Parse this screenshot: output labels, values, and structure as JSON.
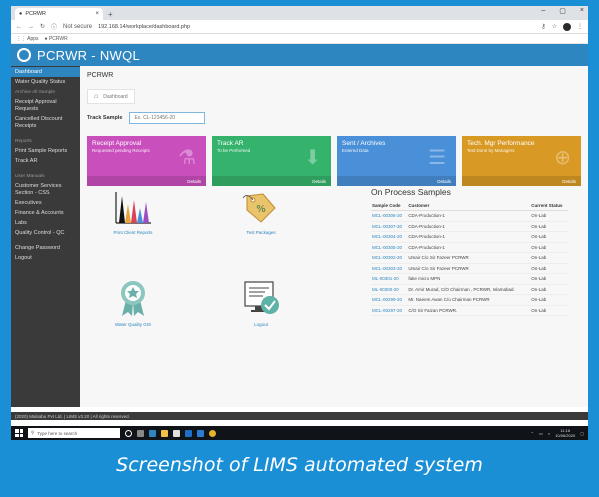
{
  "browser": {
    "tab_title": "PCRWR",
    "security_label": "Not secure",
    "url": "192.168.14/workplace/dashboard.php",
    "bookmarks": [
      "Apps",
      "PCRWR"
    ]
  },
  "app": {
    "title": "PCRWR - NWQL"
  },
  "sidebar": {
    "items": [
      {
        "label": "Dashboard",
        "active": true
      },
      {
        "label": "Water Quality Status"
      },
      {
        "label": "Archive All Sample",
        "sub": true
      },
      {
        "label": "Receipt Approval Requests"
      },
      {
        "label": "Cancelled Discount Receipts"
      },
      {
        "label": "Reports",
        "sub": true,
        "gap": true
      },
      {
        "label": "Print Sample Reports"
      },
      {
        "label": "Track AR"
      },
      {
        "label": "User Manuals",
        "sub": true,
        "gap": true
      },
      {
        "label": "Customer Services Section - CSS"
      },
      {
        "label": "Executives"
      },
      {
        "label": "Finance & Accounts"
      },
      {
        "label": "Labs"
      },
      {
        "label": "Quality Control - QC"
      },
      {
        "label": "Change Password",
        "gap": true
      },
      {
        "label": "Logout"
      }
    ]
  },
  "main": {
    "page_title": "PCRWR",
    "breadcrumb": "Dashboard",
    "track": {
      "label": "Track Sample",
      "placeholder": "Ex. CL-123456-20"
    },
    "cards": [
      {
        "title": "Receipt Approval",
        "subtitle": "Requested pending Receipts",
        "footer": "Details",
        "color": "#c94fbd"
      },
      {
        "title": "Track AR",
        "subtitle": "To be Performed",
        "footer": "Details",
        "color": "#35b36c"
      },
      {
        "title": "Sent / Archives",
        "subtitle": "Entered Data",
        "footer": "Details",
        "color": "#4a90d9"
      },
      {
        "title": "Tech. Mgr Performance",
        "subtitle": "Test Done by Managers",
        "footer": "Details",
        "color": "#d99a25"
      }
    ],
    "tiles": [
      {
        "label": "Print Client Reports",
        "icon": "bar-chart-icon"
      },
      {
        "label": "Test Packages",
        "icon": "price-tag-icon"
      },
      {
        "label": "Water Quality GIS",
        "icon": "award-ribbon-icon"
      },
      {
        "label": "Logout",
        "icon": "monitor-check-icon"
      }
    ],
    "on_process": {
      "title": "On Process Samples",
      "columns": [
        "Sample Code",
        "Customer",
        "Current Status"
      ],
      "rows": [
        [
          "MCL-00306-20",
          "CDA-Production-1",
          "On-Lab"
        ],
        [
          "MCL-00307-20",
          "CDA-Production-1",
          "On-Lab"
        ],
        [
          "MCL-00304-20",
          "CDA-Production-1",
          "On-Lab"
        ],
        [
          "MCL-00305-20",
          "CDA-Production-1",
          "On-Lab"
        ],
        [
          "MCL-00302-20",
          "Umair C/o Sir Fazeer PCRWR",
          "On-Lab"
        ],
        [
          "MCL-00303-20",
          "Umair C/o Sir Fazeer PCRWR",
          "On-Lab"
        ],
        [
          "ML-00301-20",
          "fake micro MPN",
          "On-Lab"
        ],
        [
          "ML-00300-20",
          "Dr. Amir Murad, C/O Chairman , PCRWR, Islamabad.",
          "On-Lab"
        ],
        [
          "MCL-00299-20",
          "Mr. Naeem Awan C/o Chairman PCRWR",
          "On-Lab"
        ],
        [
          "MCL-00297-20",
          "C/O Sir Faizan PCRWR.",
          "On-Lab"
        ]
      ]
    }
  },
  "footer": {
    "text": "(2020) Malsabu Pvt Ltd. | LIMS v3.20 | All rights reserved."
  },
  "taskbar": {
    "search_placeholder": "Type here to search",
    "time": "11:16",
    "date": "10/06/2020"
  },
  "caption": "Screenshot of LIMS automated system"
}
